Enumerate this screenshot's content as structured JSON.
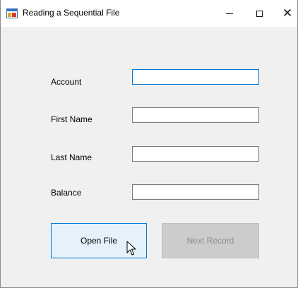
{
  "window": {
    "title": "Reading a Sequential File",
    "icon": "app-form-icon",
    "controls": {
      "minimize_icon": "minimize-icon",
      "maximize_icon": "maximize-icon",
      "close_icon": "close-icon"
    }
  },
  "form": {
    "fields": [
      {
        "label": "Account",
        "value": "",
        "focused": true
      },
      {
        "label": "First Name",
        "value": ""
      },
      {
        "label": "Last Name",
        "value": ""
      },
      {
        "label": "Balance",
        "value": ""
      }
    ]
  },
  "buttons": {
    "open_label": "Open File",
    "next_label": "Next Record",
    "next_enabled": false
  },
  "colors": {
    "focus_border": "#0078d7",
    "button_hover_bg": "#e5f1fb",
    "disabled_bg": "#cccccc",
    "disabled_text": "#8d8d8d",
    "window_bg": "#f0f0f0"
  }
}
